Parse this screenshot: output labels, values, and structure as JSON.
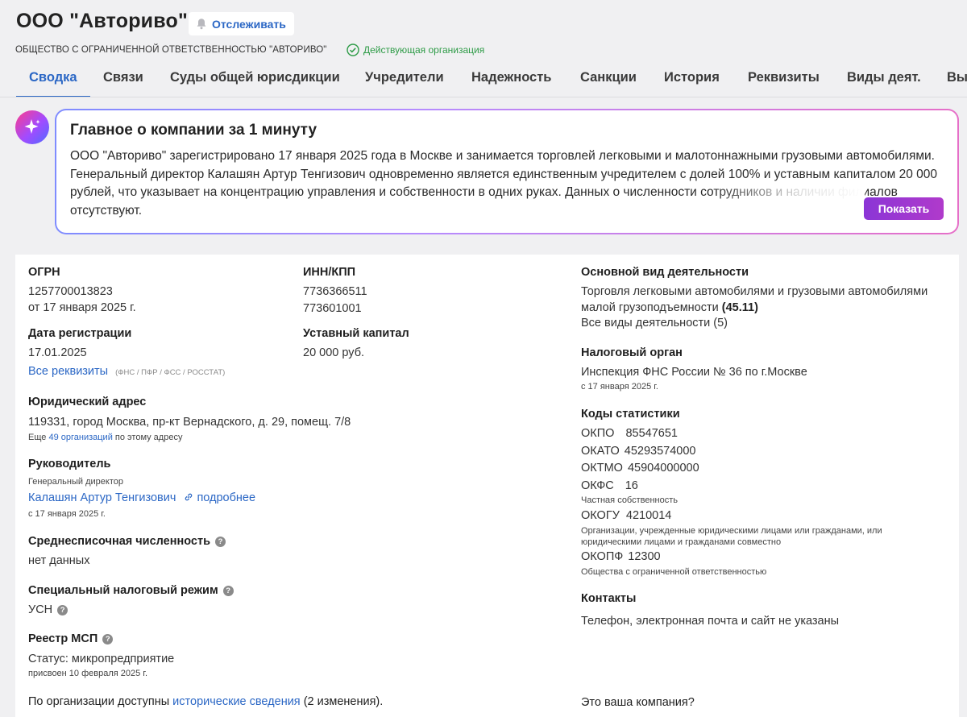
{
  "header": {
    "title": "ООО \"Авториво\"",
    "follow_label": "Отслеживать",
    "full_name": "ОБЩЕСТВО С ОГРАНИЧЕННОЙ ОТВЕТСТВЕННОСТЬЮ \"АВТОРИВО\"",
    "status": "Действующая организация"
  },
  "tabs": [
    {
      "label": "Сводка"
    },
    {
      "label": "Связи"
    },
    {
      "label": "Суды общей юрисдикции"
    },
    {
      "label": "Учредители"
    },
    {
      "label": "Надежность"
    },
    {
      "label": "Санкции"
    },
    {
      "label": "История"
    },
    {
      "label": "Реквизиты"
    },
    {
      "label": "Виды деят."
    },
    {
      "label": "Вы"
    }
  ],
  "ai_summary": {
    "title": "Главное о компании за 1 минуту",
    "text": "ООО \"Авториво\" зарегистрировано 17 января 2025 года в Москве и занимается торговлей легковыми и малотоннажными грузовыми автомобилями. Генеральный директор Калашян Артур Тенгизович одновременно является единственным учредителем с долей 100% и уставным капиталом 20 000 рублей, что указывает на концентрацию управления и собственности в одних руках. Данных о численности сотрудников и наличии филиалов отсутствуют.",
    "show_label": "Показать"
  },
  "details": {
    "ogrn": {
      "label": "ОГРН",
      "value": "1257700013823",
      "date": "от 17 января 2025 г."
    },
    "inn": {
      "label": "ИНН/КПП",
      "inn": "7736366511",
      "kpp": "773601001"
    },
    "reg_date": {
      "label": "Дата регистрации",
      "value": "17.01.2025"
    },
    "capital": {
      "label": "Уставный капитал",
      "value": "20 000 руб."
    },
    "all_requisites": {
      "link": "Все реквизиты",
      "note": "(ФНС / ПФР / ФСС / РОССТАТ)"
    },
    "address": {
      "label": "Юридический адрес",
      "value": "119331, город Москва, пр-кт Вернадского, д. 29, помещ. 7/8",
      "also_prefix": "Еще",
      "also_link": "49 организаций",
      "also_suffix": "по этому адресу"
    },
    "head": {
      "label": "Руководитель",
      "role": "Генеральный директор",
      "name": "Калашян Артур Тенгизович",
      "more": "подробнее",
      "since": "с 17 января 2025 г."
    },
    "employees": {
      "label": "Среднесписочная численность",
      "value": "нет данных"
    },
    "tax_regime": {
      "label": "Специальный налоговый режим",
      "value": "УСН"
    },
    "msp": {
      "label": "Реестр МСП",
      "status": "Статус: микропредприятие",
      "assigned": "присвоен 10 февраля 2025 г."
    },
    "history": {
      "prefix": "По организации доступны",
      "link": "исторические сведения",
      "suffix": "(2 изменения)."
    },
    "activity": {
      "label": "Основной вид деятельности",
      "line1": "Торговля легковыми автомобилями и грузовыми автомобилями",
      "line2": "малой грузоподъемности",
      "code": "(45.11)",
      "all_link": "Все виды деятельности (5)"
    },
    "tax_office": {
      "label": "Налоговый орган",
      "value": "Инспекция ФНС России № 36 по г.Москве",
      "since": "с 17 января 2025 г."
    },
    "stat_codes": {
      "label": "Коды статистики",
      "okpo": {
        "k": "ОКПО",
        "v": "85547651"
      },
      "okato": {
        "k": "ОКАТО",
        "v": "45293574000"
      },
      "oktmo": {
        "k": "ОКТМО",
        "v": "45904000000"
      },
      "okfs": {
        "k": "ОКФС",
        "v": "16",
        "note": "Частная собственность"
      },
      "okogu": {
        "k": "ОКОГУ",
        "v": "4210014",
        "note1": "Организации, учрежденные юридическими лицами или гражданами, или",
        "note2": "юридическими лицами и гражданами совместно"
      },
      "okopf": {
        "k": "ОКОПФ",
        "v": "12300",
        "note": "Общества с ограниченной ответственностью"
      }
    },
    "contacts": {
      "label": "Контакты",
      "value": "Телефон, электронная почта и сайт не указаны"
    },
    "your_company": "Это ваша компания?"
  }
}
